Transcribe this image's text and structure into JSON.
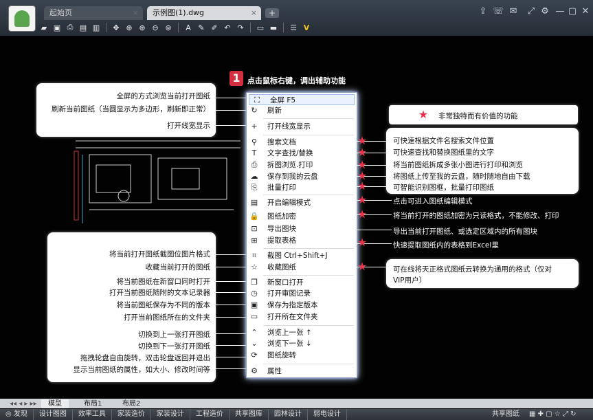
{
  "tabs": [
    {
      "label": "起始页"
    },
    {
      "label": "示例图(1).dwg"
    }
  ],
  "tab_add": "+",
  "tab_close": "×",
  "step_badge": "1",
  "step_text": "点击鼠标右键，调出辅助功能",
  "left_box1": [
    "全屏的方式浏览当前打开图纸",
    "刷新当前图纸（当圆显示为多边形，刷新即正常）",
    "打开线宽显示"
  ],
  "left_box2": [
    "将当前打开图纸截图位图片格式",
    "收藏当前打开的图纸",
    "将当前图纸在新窗口同时打开",
    "打开当前图纸随附的文本记录器",
    "将当前图纸保存为不同的版本",
    "打开当前图纸所在的文件夹",
    "切换到上一张打开图纸",
    "切换到下一张打开图纸",
    "拖拽轮盘自由旋转，双击轮盘返回并退出",
    "显示当前图纸的属性，如大小、修改时间等"
  ],
  "legend_text": "非常独特而有价值的功能",
  "right_box": [
    "可快速根据文件名搜索文件位置",
    "可快速查找和替换图纸里的文字",
    "将当前图纸拆成多张小图进行打印和浏览",
    "将图纸上传至我的云盘，随时随地自由下载",
    "可智能识别图框，批量打印图纸"
  ],
  "right_lines": [
    "点击可进入图纸编辑模式",
    "将当前打开的图纸加密为只读格式，不能修改、打印",
    "导出当前打开图纸、或选定区域内的所有图块",
    "快速提取图纸内的表格到Excel里"
  ],
  "right_box_last": [
    "可在线将天正格式图纸云转换为通用的格式（仅对",
    "VIP用户）"
  ],
  "menu": [
    {
      "label": "全屏 F5",
      "icon": "fullscreen-icon",
      "glyph": "⛶"
    },
    {
      "label": "刷新",
      "icon": "refresh-icon",
      "glyph": "↻"
    },
    {
      "label": "打开线宽显示",
      "icon": "plus-icon",
      "glyph": "+"
    },
    {
      "label": "搜索文档",
      "icon": "search-icon",
      "glyph": "⚲"
    },
    {
      "label": "文字查找/替换",
      "icon": "text-icon",
      "glyph": "T"
    },
    {
      "label": "拆图浏览.打印",
      "icon": "print-icon",
      "glyph": "⎙"
    },
    {
      "label": "保存到我的云盘",
      "icon": "cloud-upload-icon",
      "glyph": "☁"
    },
    {
      "label": "批量打印",
      "icon": "batch-print-icon",
      "glyph": "⎘"
    },
    {
      "label": "开启编辑模式",
      "icon": "edit-mode-icon",
      "glyph": "▤"
    },
    {
      "label": "图纸加密",
      "icon": "lock-icon",
      "glyph": "🔒"
    },
    {
      "label": "导出图块",
      "icon": "export-block-icon",
      "glyph": "⊡"
    },
    {
      "label": "提取表格",
      "icon": "table-icon",
      "glyph": "⊞"
    },
    {
      "label": "截图 Ctrl+Shift+J",
      "icon": "crop-icon",
      "glyph": "⌗"
    },
    {
      "label": "收藏图纸",
      "icon": "star-outline-icon",
      "glyph": "☆"
    },
    {
      "label": "新窗口打开",
      "icon": "new-window-icon",
      "glyph": "❐"
    },
    {
      "label": "打开审图记录",
      "icon": "clock-icon",
      "glyph": "◷"
    },
    {
      "label": "保存为指定版本",
      "icon": "save-icon",
      "glyph": "▣"
    },
    {
      "label": "打开所在文件夹",
      "icon": "folder-icon",
      "glyph": "▭"
    },
    {
      "label": "浏览上一张 ↑",
      "icon": "up-circle-icon",
      "glyph": "⌃"
    },
    {
      "label": "浏览下一张 ↓",
      "icon": "down-circle-icon",
      "glyph": "⌄"
    },
    {
      "label": "图纸旋转",
      "icon": "rotate-icon",
      "glyph": "⟳"
    },
    {
      "label": "属性",
      "icon": "gear-icon",
      "glyph": "⚙"
    }
  ],
  "bottom_tabs": [
    "模型",
    "布局1",
    "布局2"
  ],
  "status_items": [
    "发现",
    "设计图图",
    "效率工具",
    "家装造价",
    "家装设计",
    "工程造价",
    "共享图库",
    "园林设计",
    "弱电设计"
  ],
  "status_right": "共享图纸",
  "accent_red": "#e8344e"
}
